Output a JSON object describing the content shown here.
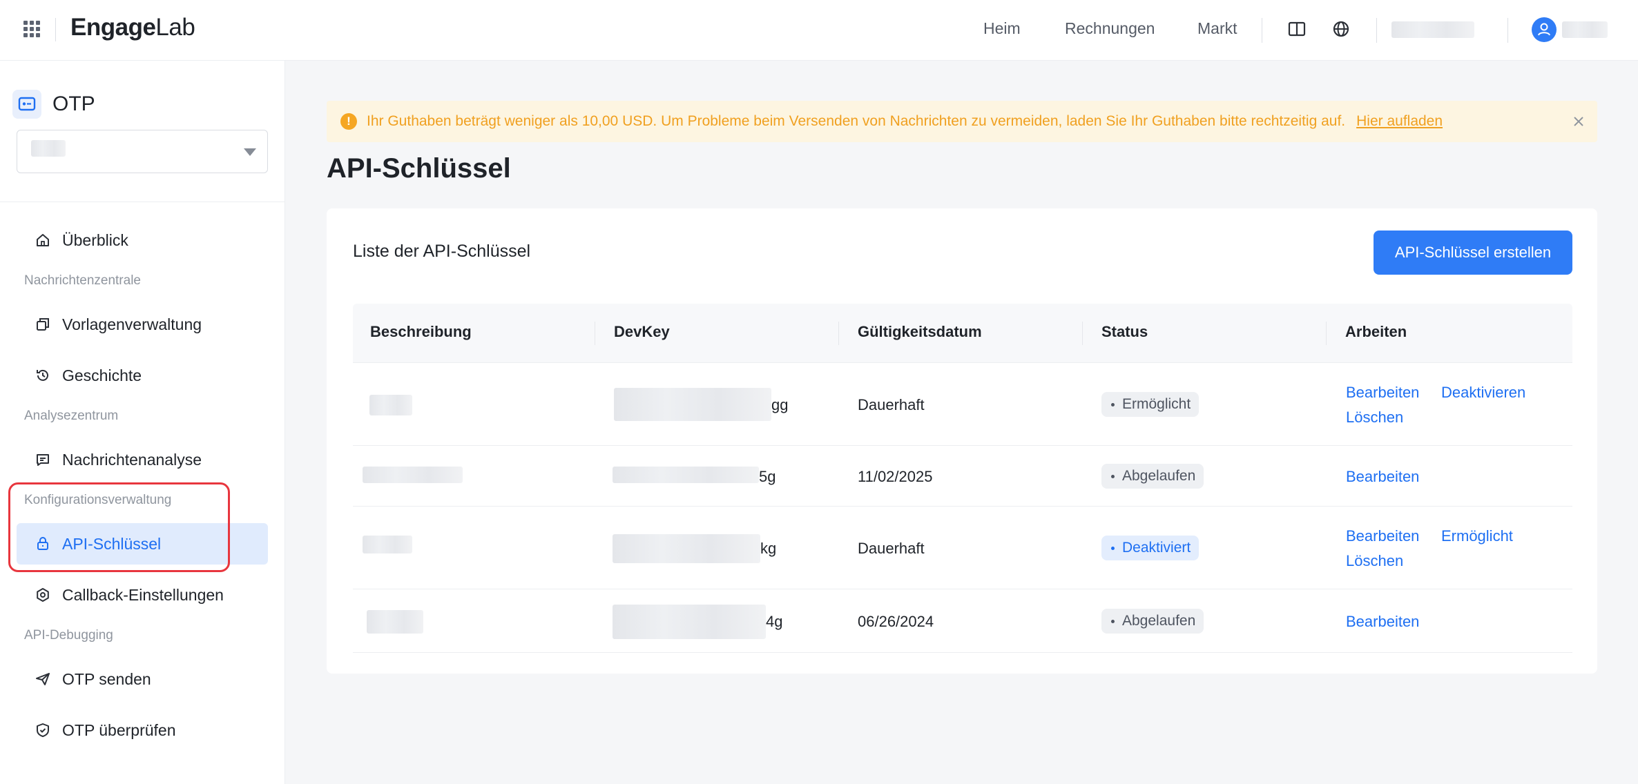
{
  "header": {
    "logo_prefix": "Eng",
    "logo_mid": "age",
    "logo_suffix": "Lab",
    "nav": [
      "Heim",
      "Rechnungen",
      "Markt"
    ]
  },
  "sidebar": {
    "product": "OTP",
    "overview": "Überblick",
    "groups": {
      "message_center": "Nachrichtenzentrale",
      "analysis": "Analysezentrum",
      "config": "Konfigurationsverwaltung",
      "api_debug": "API-Debugging"
    },
    "items": {
      "templates": "Vorlagenverwaltung",
      "history": "Geschichte",
      "message_analysis": "Nachrichtenanalyse",
      "api_keys": "API-Schlüssel",
      "callback": "Callback-Einstellungen",
      "send_otp": "OTP senden",
      "verify_otp": "OTP überprüfen"
    }
  },
  "banner": {
    "text": "Ihr Guthaben beträgt weniger als 10,00 USD. Um Probleme beim Versenden von Nachrichten zu vermeiden, laden Sie Ihr Guthaben bitte rechtzeitig auf.",
    "link": "Hier aufladen"
  },
  "page": {
    "title": "API-Schlüssel"
  },
  "card": {
    "title": "Liste der API-Schlüssel",
    "create_button": "API-Schlüssel erstellen"
  },
  "table": {
    "columns": [
      "Beschreibung",
      "DevKey",
      "Gültigkeitsdatum",
      "Status",
      "Arbeiten"
    ],
    "rows": [
      {
        "devkey_suffix": "gg",
        "validity": "Dauerhaft",
        "status": "Ermöglicht",
        "actions": [
          "Bearbeiten",
          "Deaktivieren",
          "Löschen"
        ]
      },
      {
        "devkey_suffix": "5g",
        "validity": "11/02/2025",
        "status": "Abgelaufen",
        "actions": [
          "Bearbeiten"
        ]
      },
      {
        "devkey_suffix": "kg",
        "validity": "Dauerhaft",
        "status": "Deaktiviert",
        "actions": [
          "Bearbeiten",
          "Ermöglicht",
          "Löschen"
        ]
      },
      {
        "devkey_suffix": "4g",
        "validity": "06/26/2024",
        "status": "Abgelaufen",
        "actions": [
          "Bearbeiten"
        ]
      }
    ]
  },
  "colors": {
    "primary": "#2f7cf6",
    "warning_text": "#f0a020",
    "warning_bg": "#fdf5e1",
    "highlight": "#e8363e"
  }
}
